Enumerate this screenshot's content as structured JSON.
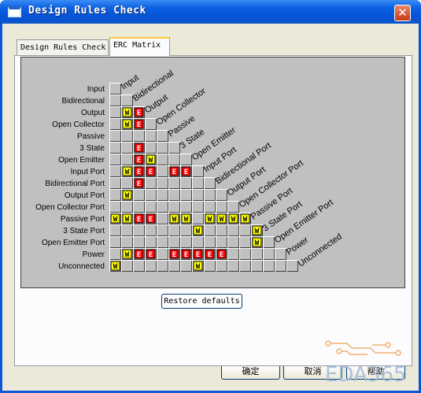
{
  "window": {
    "title": "Design Rules Check"
  },
  "tabs": [
    {
      "label": "Design Rules Check",
      "active": false
    },
    {
      "label": "ERC Matrix",
      "active": true
    }
  ],
  "matrix": {
    "rows": [
      "Input",
      "Bidirectional",
      "Output",
      "Open Collector",
      "Passive",
      "3 State",
      "Open Emitter",
      "Input Port",
      "Bidirectional Port",
      "Output Port",
      "Open Collector Port",
      "Passive Port",
      "3 State Port",
      "Open Emitter Port",
      "Power",
      "Unconnected"
    ],
    "cells": [
      [
        "."
      ],
      [
        ".",
        "."
      ],
      [
        ".",
        "W",
        "E"
      ],
      [
        ".",
        "W",
        "E",
        "."
      ],
      [
        ".",
        ".",
        ".",
        ".",
        "."
      ],
      [
        ".",
        ".",
        "E",
        ".",
        ".",
        "."
      ],
      [
        ".",
        ".",
        "E",
        "W",
        ".",
        ".",
        "."
      ],
      [
        ".",
        "W",
        "E",
        "E",
        ".",
        "E",
        "E",
        "."
      ],
      [
        ".",
        ".",
        "E",
        ".",
        ".",
        ".",
        ".",
        ".",
        "."
      ],
      [
        ".",
        "W",
        ".",
        ".",
        ".",
        ".",
        ".",
        ".",
        ".",
        "."
      ],
      [
        ".",
        ".",
        ".",
        ".",
        ".",
        ".",
        ".",
        ".",
        ".",
        ".",
        "."
      ],
      [
        "W",
        "W",
        "E",
        "E",
        ".",
        "W",
        "W",
        ".",
        "W",
        "W",
        "W",
        "W"
      ],
      [
        ".",
        ".",
        ".",
        ".",
        ".",
        ".",
        ".",
        "W",
        ".",
        ".",
        ".",
        ".",
        "W"
      ],
      [
        ".",
        ".",
        ".",
        ".",
        ".",
        ".",
        ".",
        ".",
        ".",
        ".",
        ".",
        ".",
        "W",
        "."
      ],
      [
        ".",
        "W",
        "E",
        "E",
        ".",
        "E",
        "E",
        "E",
        "E",
        "E",
        ".",
        ".",
        ".",
        ".",
        "."
      ],
      [
        "W",
        ".",
        ".",
        ".",
        ".",
        ".",
        ".",
        "W",
        ".",
        ".",
        ".",
        ".",
        ".",
        ".",
        ".",
        "."
      ]
    ],
    "legend": {
      "warning": "W",
      "error": "E"
    },
    "colors": {
      "ok": "#c0c0c0",
      "warning": "#ffff00",
      "error": "#ff0000",
      "background": "#c0c0c0"
    }
  },
  "buttons": {
    "restore": "Restore defaults",
    "ok": "确定",
    "cancel": "取消",
    "help": "帮助"
  },
  "watermark": {
    "text": "EDA365"
  }
}
